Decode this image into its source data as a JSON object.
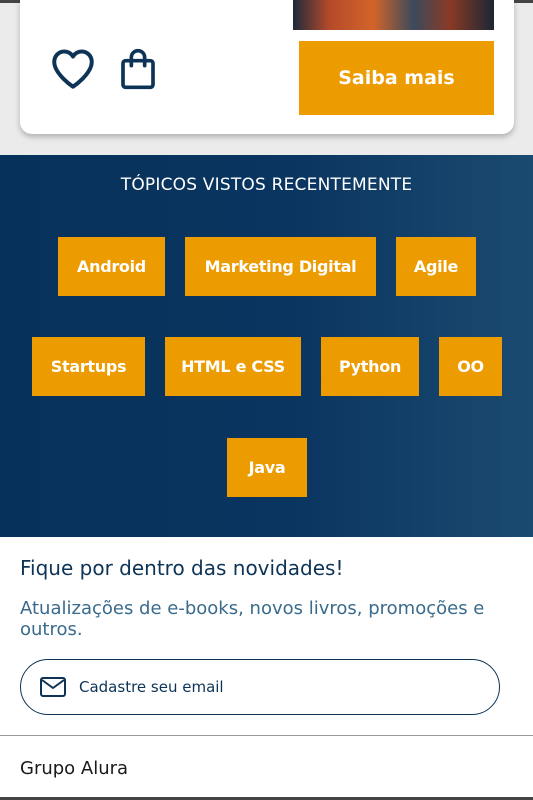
{
  "product_card": {
    "heart_icon": "heart-outline-icon",
    "bag_icon": "shopping-bag-icon",
    "cta_label": "Saiba mais",
    "accent_color": "#ec9b00"
  },
  "topics": {
    "title": "TÓPICOS VISTOS RECENTEMENTE",
    "items": [
      {
        "label": "Android"
      },
      {
        "label": "Marketing Digital"
      },
      {
        "label": "Agile"
      },
      {
        "label": "Startups"
      },
      {
        "label": "HTML e CSS"
      },
      {
        "label": "Python"
      },
      {
        "label": "OO"
      },
      {
        "label": "Java"
      }
    ]
  },
  "newsletter": {
    "title": "Fique por dentro das novidades!",
    "description": "Atualizações de e-books, novos livros, promoções e outros.",
    "email_placeholder": "Cadastre seu email",
    "email_icon": "mail-icon"
  },
  "footer": {
    "link_label": "Grupo Alura"
  }
}
